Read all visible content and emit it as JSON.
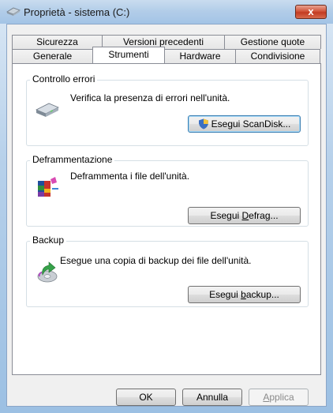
{
  "window": {
    "title": "Proprietà - sistema (C:)",
    "close_label": "x"
  },
  "tabs": {
    "back_row": [
      "Sicurezza",
      "Versioni precedenti",
      "Gestione quote"
    ],
    "front_row": [
      "Generale",
      "Strumenti",
      "Hardware",
      "Condivisione"
    ],
    "active": "Strumenti"
  },
  "groups": {
    "error_check": {
      "title": "Controllo errori",
      "description": "Verifica la presenza di errori nell'unità.",
      "button_label": "Esegui ScanDisk...",
      "icon": "drive-icon"
    },
    "defrag": {
      "title": "Deframmentazione",
      "description": "Deframmenta i file dell'unità.",
      "button_pre": "Esegui ",
      "button_key": "D",
      "button_post": "efrag...",
      "icon": "defrag-icon"
    },
    "backup": {
      "title": "Backup",
      "description": "Esegue una copia di backup dei file dell'unità.",
      "button_pre": "Esegui ",
      "button_key": "b",
      "button_post": "ackup...",
      "icon": "backup-icon"
    }
  },
  "footer": {
    "ok_label": "OK",
    "cancel_label": "Annulla",
    "apply_key": "A",
    "apply_rest": "pplica"
  },
  "colors": {
    "titlebar": "#b1cce8",
    "close": "#c23b22",
    "panel": "#ffffff",
    "dialog": "#f0f0f0"
  }
}
